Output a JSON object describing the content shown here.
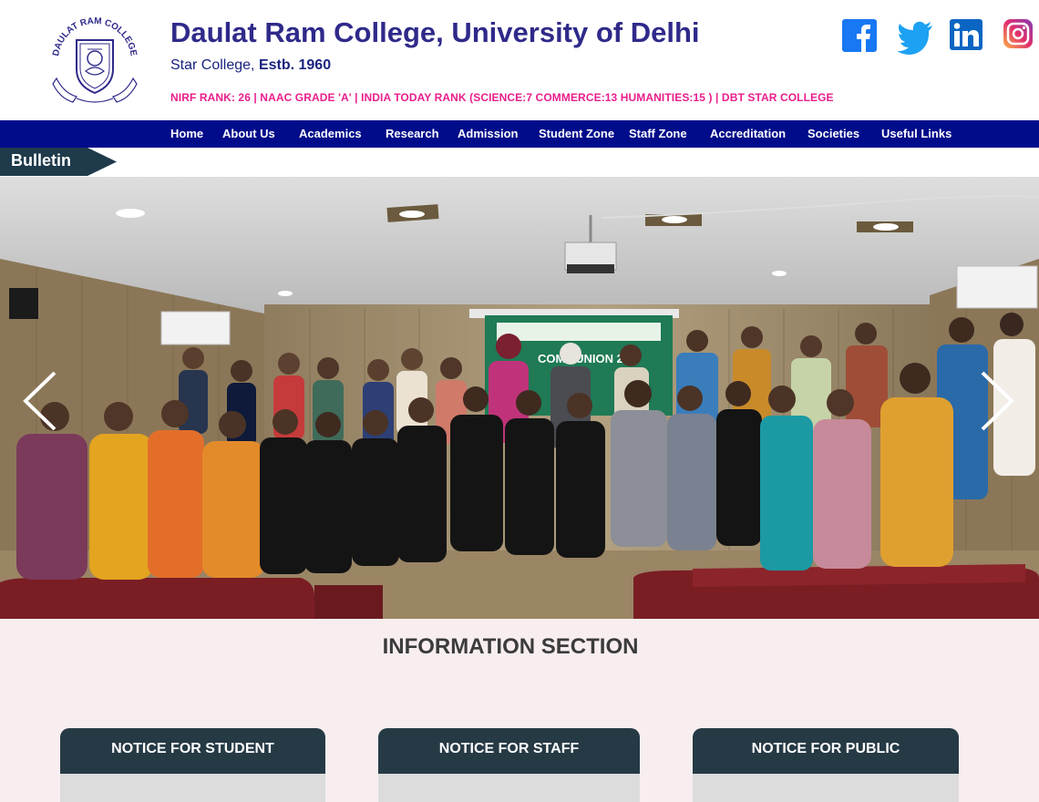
{
  "header": {
    "college_name": "Daulat Ram College, University of Delhi",
    "tagline_prefix": "Star College, ",
    "tagline_estb": "Estb. 1960",
    "rank_line": "NIRF RANK: 26 | NAAC GRADE 'A' |  INDIA TODAY RANK (SCIENCE:7 COMMERCE:13 HUMANITIES:15 ) | DBT STAR COLLEGE",
    "logo_text": "DAULAT RAM COLLEGE"
  },
  "social": [
    {
      "name": "facebook-icon",
      "color": "#1877f2"
    },
    {
      "name": "twitter-icon",
      "color": "#1da1f2"
    },
    {
      "name": "linkedin-icon",
      "color": "#0a66c2"
    },
    {
      "name": "instagram-icon",
      "color": "#e1306c"
    }
  ],
  "nav": {
    "items": [
      "Home",
      "About Us",
      "Academics",
      "Research",
      "Admission",
      "Student Zone",
      "Staff Zone",
      "Accreditation",
      "Societies",
      "Useful Links"
    ]
  },
  "bulletin": {
    "label": "Bulletin"
  },
  "hero": {
    "banner_text": "COMMUNION 20"
  },
  "info": {
    "title": "INFORMATION SECTION",
    "cards": [
      {
        "label": "NOTICE FOR STUDENT"
      },
      {
        "label": "NOTICE FOR STAFF"
      },
      {
        "label": "NOTICE FOR PUBLIC"
      }
    ]
  },
  "colors": {
    "brand_purple": "#2f2a8a",
    "rank_pink": "#e91e8c",
    "nav_blue": "#000c8a",
    "bulletin_dark": "#1f3a4a",
    "card_head": "#263a45",
    "section_bg": "#f8eeef"
  }
}
